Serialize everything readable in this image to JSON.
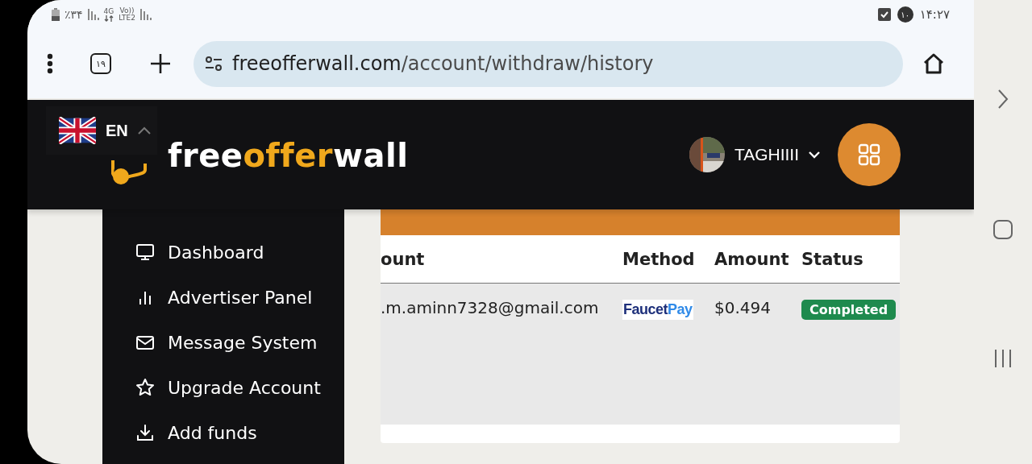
{
  "status_bar": {
    "battery_text": "٪۳۴",
    "network": "4G",
    "volte": "Vo))",
    "lte": "LTE2",
    "notification_count": "۱۰",
    "time": "۱۴:۲۷"
  },
  "browser": {
    "tab_count": "۱۹",
    "url_domain": "freeofferwall.com",
    "url_path": "/account/withdraw/history"
  },
  "header": {
    "language": "EN",
    "logo_parts": [
      "free",
      "offer",
      "wall"
    ],
    "user_name": "TAGHIIII"
  },
  "sidebar": {
    "items": [
      {
        "label": "Dashboard",
        "kind": "monitor"
      },
      {
        "label": "Advertiser Panel",
        "kind": "bars"
      },
      {
        "label": "Message System",
        "kind": "mail"
      },
      {
        "label": "Upgrade Account",
        "kind": "star"
      },
      {
        "label": "Add funds",
        "kind": "download"
      }
    ]
  },
  "table": {
    "columns": [
      "ount",
      "Method",
      "Amount",
      "Status"
    ],
    "rows": [
      {
        "account": ".m.aminn7328@gmail.com",
        "method_logo": [
          "Faucet",
          "Pay"
        ],
        "amount": "$0.494",
        "status": "Completed",
        "color": "#1e8a4e"
      }
    ]
  }
}
